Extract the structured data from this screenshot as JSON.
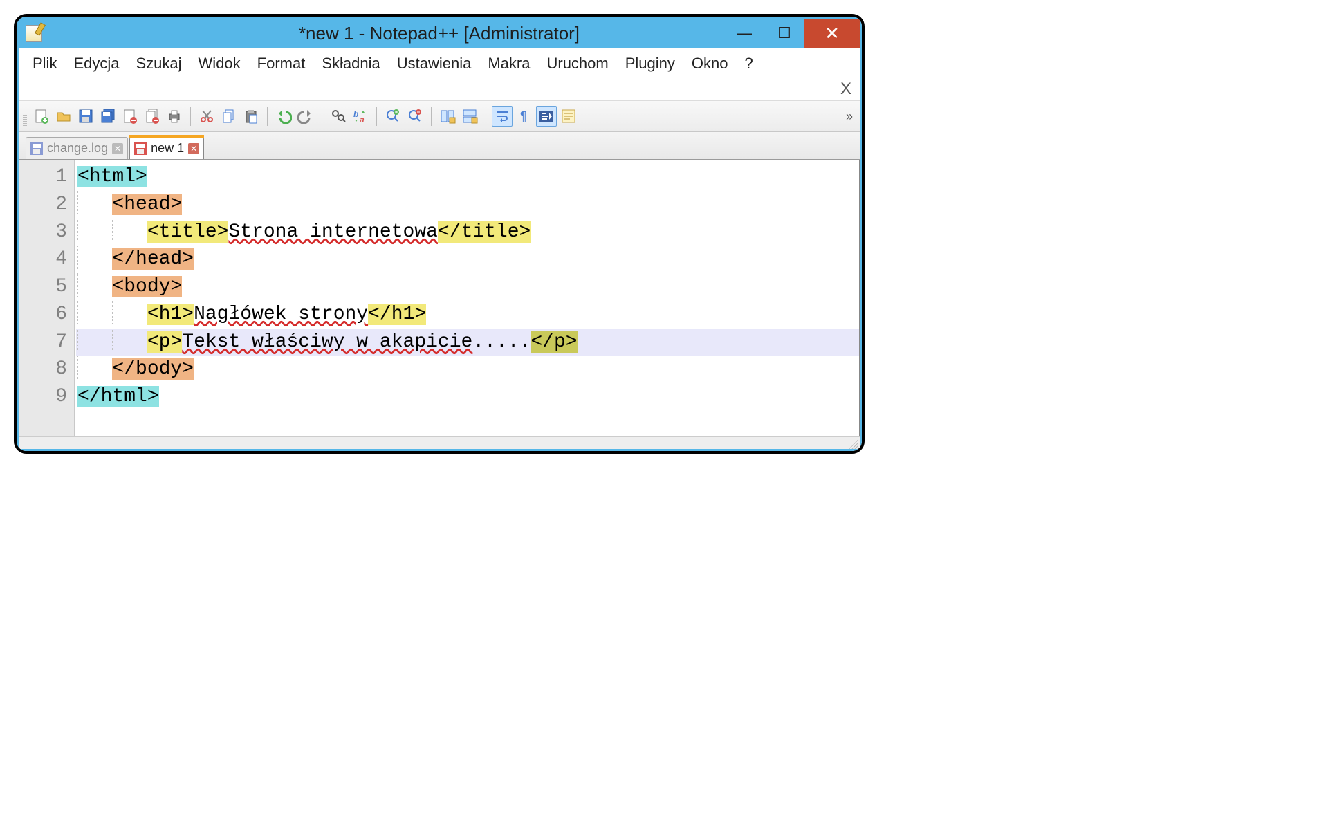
{
  "title": "*new  1 - Notepad++ [Administrator]",
  "menu": [
    "Plik",
    "Edycja",
    "Szukaj",
    "Widok",
    "Format",
    "Składnia",
    "Ustawienia",
    "Makra",
    "Uruchom",
    "Pluginy",
    "Okno",
    "?"
  ],
  "sub_close": "X",
  "win_controls": {
    "min": "—",
    "max": "☐",
    "close": "✕"
  },
  "tabs": [
    {
      "label": "change.log",
      "active": false,
      "dirty": false
    },
    {
      "label": "new  1",
      "active": true,
      "dirty": true
    }
  ],
  "toolbar": {
    "buttons": [
      "new-file",
      "open-file",
      "save",
      "save-all",
      "close-file",
      "close-all",
      "print",
      "cut",
      "copy",
      "paste",
      "undo",
      "redo",
      "find",
      "find-replace",
      "zoom-in",
      "zoom-out",
      "sync-v",
      "sync-h",
      "wrap",
      "show-all",
      "indent-guide",
      "function-list"
    ],
    "active": [
      "wrap",
      "indent-guide"
    ]
  },
  "code": {
    "current_line": 7,
    "lines": [
      {
        "n": 1,
        "indent": 0,
        "segments": [
          {
            "t": "<html>",
            "c": "hl-cyan"
          }
        ]
      },
      {
        "n": 2,
        "indent": 1,
        "segments": [
          {
            "t": "<head>",
            "c": "hl-orange"
          }
        ]
      },
      {
        "n": 3,
        "indent": 2,
        "segments": [
          {
            "t": "<title>",
            "c": "hl-yellow"
          },
          {
            "t": "Strona internetowa",
            "c": "txt-spell"
          },
          {
            "t": "</title>",
            "c": "hl-yellow"
          }
        ]
      },
      {
        "n": 4,
        "indent": 1,
        "segments": [
          {
            "t": "</head>",
            "c": "hl-orange"
          }
        ]
      },
      {
        "n": 5,
        "indent": 1,
        "segments": [
          {
            "t": "<body>",
            "c": "hl-orange"
          }
        ]
      },
      {
        "n": 6,
        "indent": 2,
        "segments": [
          {
            "t": "<h1>",
            "c": "hl-yellow"
          },
          {
            "t": "Nagłówek strony",
            "c": "txt-spell"
          },
          {
            "t": "</h1>",
            "c": "hl-yellow"
          }
        ]
      },
      {
        "n": 7,
        "indent": 2,
        "segments": [
          {
            "t": "<p>",
            "c": "hl-yellow"
          },
          {
            "t": "Tekst właściwy w akapicie",
            "c": "txt-spell"
          },
          {
            "t": ".....",
            "c": ""
          },
          {
            "t": "</p>",
            "c": "hl-olive"
          }
        ],
        "caret_after": true
      },
      {
        "n": 8,
        "indent": 1,
        "segments": [
          {
            "t": "</body>",
            "c": "hl-orange"
          }
        ]
      },
      {
        "n": 9,
        "indent": 0,
        "segments": [
          {
            "t": "</html>",
            "c": "hl-cyan"
          }
        ]
      }
    ]
  },
  "overflow_glyph": "»"
}
